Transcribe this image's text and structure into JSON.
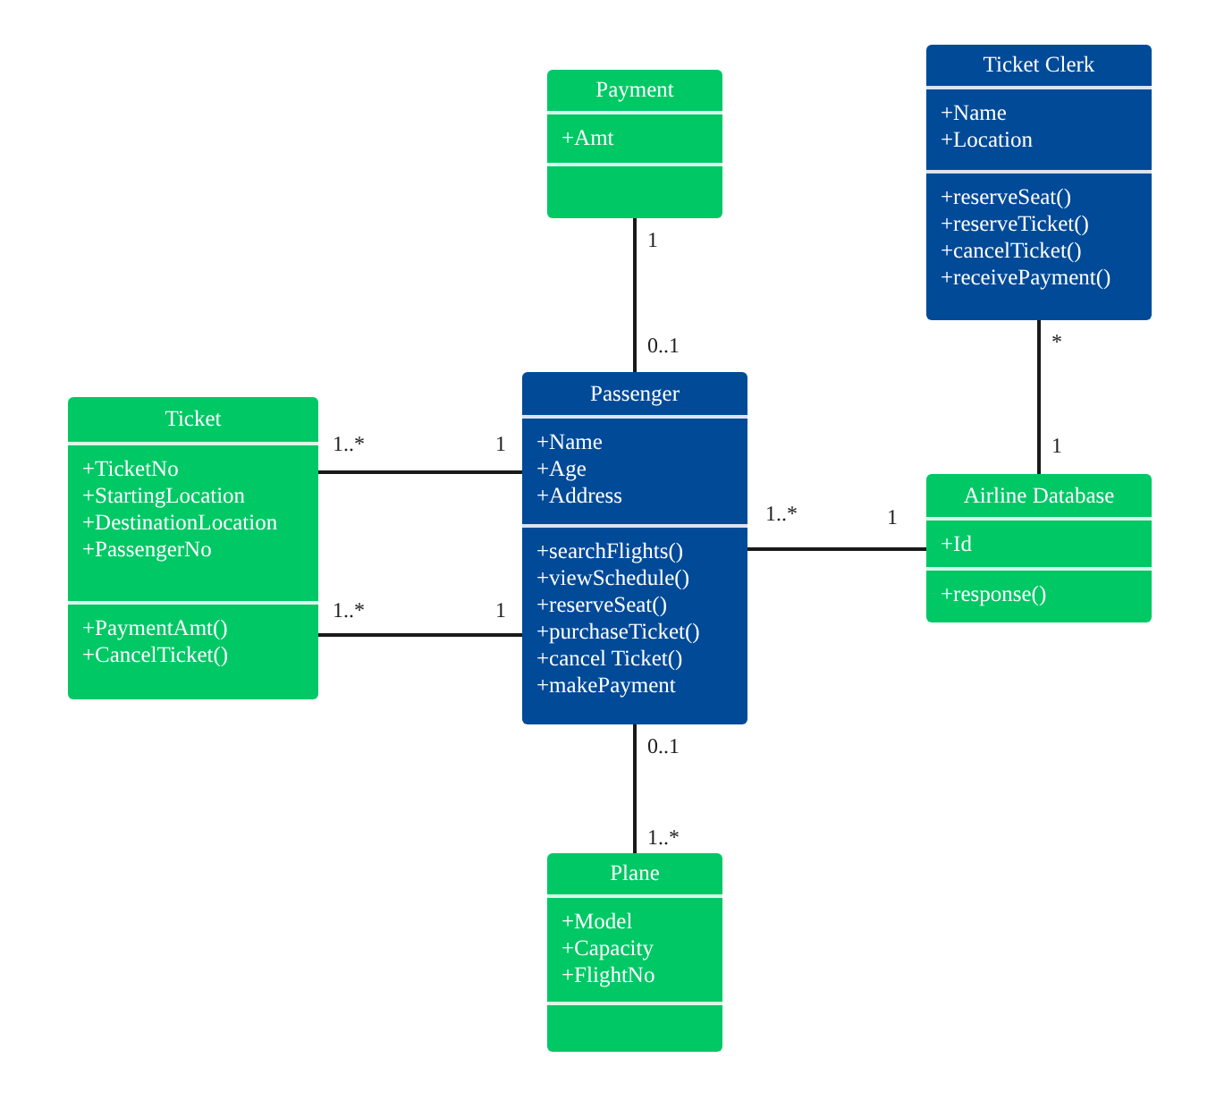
{
  "classes": [
    {
      "name": "Payment",
      "color": "#00c865",
      "attributes": [
        "+Amt"
      ]
    },
    {
      "name": "Ticket Clerk",
      "color": "#004a98",
      "attributes": [
        "+Name",
        "+Location"
      ],
      "methods": [
        "+reserveSeat()",
        "+reserveTicket()",
        "+cancelTicket()",
        "+receivePayment()"
      ]
    },
    {
      "name": "Ticket",
      "color": "#00c865",
      "attributes": [
        "+TicketNo",
        "+StartingLocation",
        "+DestinationLocation",
        "+PassengerNo"
      ],
      "methods": [
        "+PaymentAmt()",
        "+CancelTicket()"
      ]
    },
    {
      "name": "Passenger",
      "color": "#004a98",
      "attributes": [
        "+Name",
        "+Age",
        "+Address"
      ],
      "methods": [
        "+searchFlights()",
        "+viewSchedule()",
        "+reserveSeat()",
        "+purchaseTicket()",
        "+cancel Ticket()",
        "+makePayment"
      ]
    },
    {
      "name": "Airline Database",
      "color": "#00c865",
      "attributes": [
        "+Id"
      ],
      "methods": [
        "+response()"
      ]
    },
    {
      "name": "Plane",
      "color": "#00c865",
      "attributes": [
        "+Model",
        "+Capacity",
        "+FlightNo"
      ]
    }
  ],
  "associations": [
    {
      "end_a": "1",
      "end_b": "0..1"
    },
    {
      "end_a": "1..*",
      "end_b": "1"
    },
    {
      "end_a": "1..*",
      "end_b": "1"
    },
    {
      "end_a": "1..*",
      "end_b": "1"
    },
    {
      "end_a": "*",
      "end_b": "1"
    },
    {
      "end_a": "0..1",
      "end_b": "1..*"
    }
  ]
}
